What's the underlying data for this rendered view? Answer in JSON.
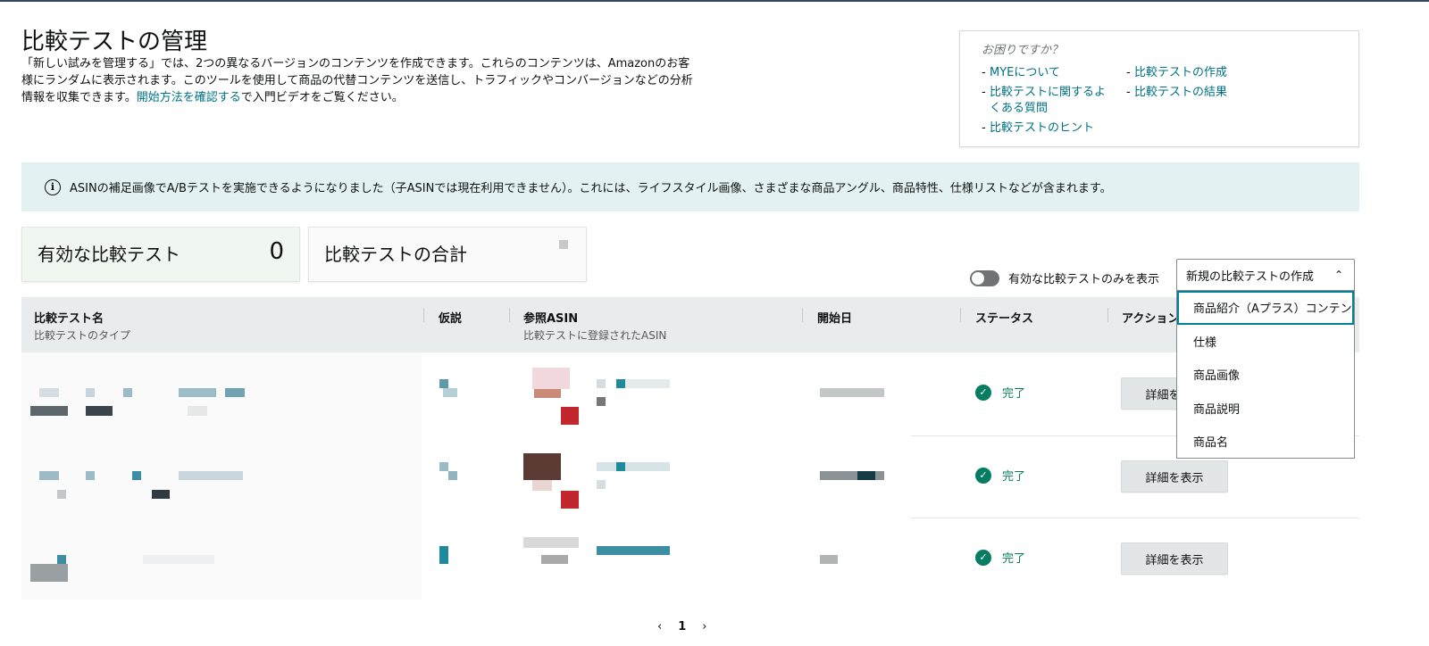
{
  "page": {
    "title": "比較テストの管理",
    "intro_text": "「新しい試みを管理する」では、2つの異なるバージョンのコンテンツを作成できます。これらのコンテンツは、Amazonのお客様にランダムに表示されます。このツールを使用して商品の代替コンテンツを送信し、トラフィックやコンバージョンなどの分析情報を収集できます。",
    "intro_link": "開始方法を確認する",
    "intro_suffix": "で入門ビデオをご覧ください。"
  },
  "help": {
    "title": "お困りですか？",
    "col1": [
      "MYEについて",
      "比較テストに関するよくある質問",
      "比較テストのヒント"
    ],
    "col2": [
      "比較テストの作成",
      "比較テストの結果"
    ]
  },
  "alert": {
    "icon": "info-icon",
    "text": "ASINの補足画像でA/Bテストを実施できるようになりました（子ASINでは現在利用できません）。これには、ライフスタイル画像、さまざまな商品アングル、商品特性、仕様リストなどが含まれます。"
  },
  "stats": {
    "active_label": "有効な比較テスト",
    "active_value": "0",
    "total_label": "比較テストの合計"
  },
  "toolbar": {
    "toggle_label": "有効な比較テストのみを表示",
    "toggle_on": false,
    "create_label": "新規の比較テストの作成"
  },
  "dropdown": {
    "options": [
      "商品紹介（Aプラス）コンテンツ",
      "仕様",
      "商品画像",
      "商品説明",
      "商品名"
    ],
    "highlighted_index": 0
  },
  "table": {
    "headers": {
      "name": "比較テスト名",
      "name_sub": "比較テストのタイプ",
      "hypothesis": "仮説",
      "asin": "参照ASIN",
      "asin_sub": "比較テストに登録されたASIN",
      "start": "開始日",
      "status": "ステータス",
      "action": "アクション"
    },
    "rows": [
      {
        "status": "完了",
        "action": "詳細を表示"
      },
      {
        "status": "完了",
        "action": "詳細を表示"
      },
      {
        "status": "完了",
        "action": "詳細を表示"
      }
    ]
  },
  "pagination": {
    "prev": "‹",
    "current": "1",
    "next": "›"
  },
  "colors": {
    "link": "#007185",
    "success": "#067d62",
    "alert_bg": "#e3f1f2",
    "header_bg": "#e9ecec",
    "focus_border": "#008296"
  }
}
